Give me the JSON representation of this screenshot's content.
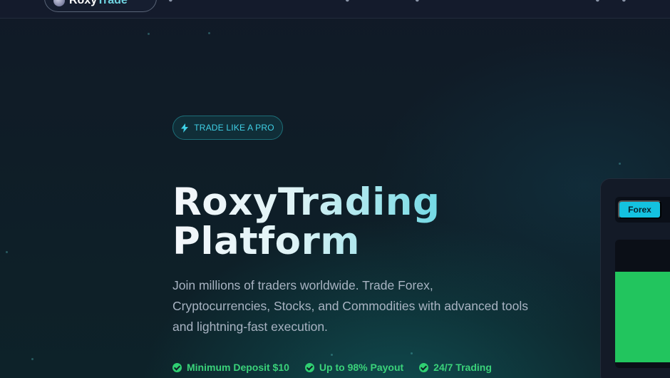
{
  "nav": {
    "logo": {
      "part1": "Roxy",
      "part2": "Trade"
    }
  },
  "hero": {
    "badge": "TRADE LIKE A PRO",
    "title_line1": "RoxyTrading",
    "title_line2": "Platform",
    "subtitle": "Join millions of traders worldwide. Trade Forex, Cryptocurrencies, Stocks, and Commodities with advanced tools and lightning-fast execution.",
    "features": [
      "Minimum Deposit $10",
      "Up to 98% Payout",
      "24/7 Trading"
    ]
  },
  "trade_card": {
    "active_tab": "Forex"
  },
  "colors": {
    "accent": "#14c2e0",
    "success": "#2fcf72",
    "background": "#0f1d27"
  }
}
